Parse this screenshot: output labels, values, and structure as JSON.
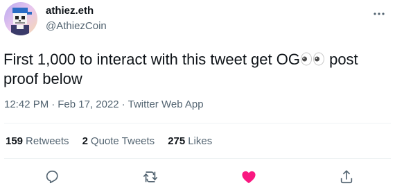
{
  "tweet": {
    "author": {
      "display_name": "athiez.eth",
      "handle": "@AthiezCoin",
      "avatar_icon": "pixel-skull-avatar"
    },
    "text_before_emoji": "First 1,000 to interact with this tweet get OG",
    "emoji": "eyes-emoji",
    "text_after_emoji": " post proof below",
    "time": "12:42 PM",
    "date": "Feb 17, 2022",
    "source": "Twitter Web App",
    "stats": {
      "retweets_count": "159",
      "retweets_label": "Retweets",
      "quote_count": "2",
      "quote_label": "Quote Tweets",
      "likes_count": "275",
      "likes_label": "Likes"
    },
    "actions": {
      "reply_icon": "reply-icon",
      "retweet_icon": "retweet-icon",
      "like_icon": "heart-icon",
      "share_icon": "share-icon",
      "liked": true
    }
  },
  "colors": {
    "text_primary": "#0f1419",
    "text_secondary": "#536471",
    "like_active": "#f91880",
    "divider": "#eff3f4"
  }
}
